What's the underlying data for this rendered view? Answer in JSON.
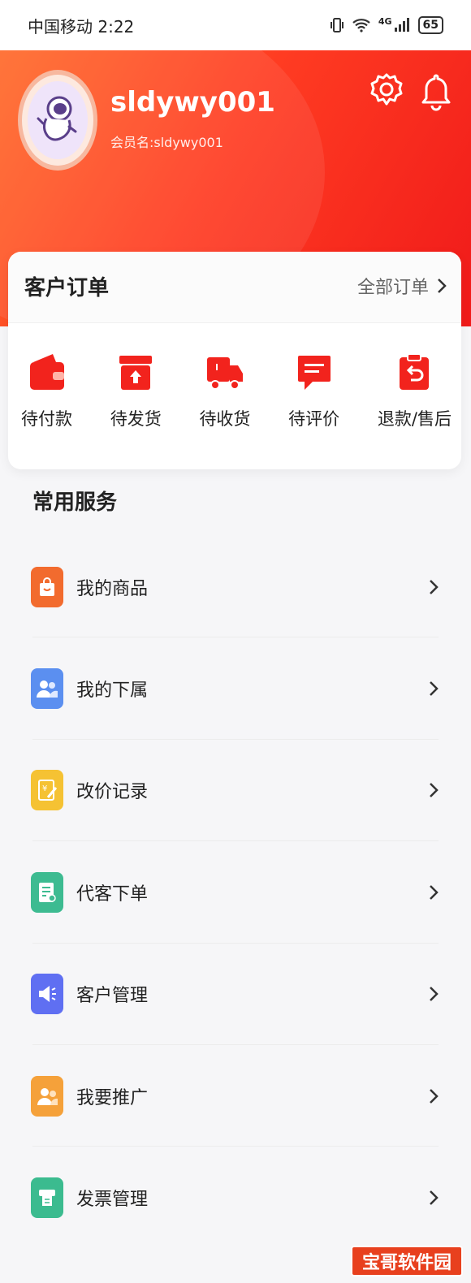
{
  "status_bar": {
    "carrier_time": "中国移动 2:22",
    "network": "4G",
    "battery": "65"
  },
  "profile": {
    "username": "sldywy001",
    "member_name": "会员名:sldywy001"
  },
  "orders": {
    "title": "客户订单",
    "all_orders_label": "全部订单",
    "items": [
      {
        "label": "待付款",
        "icon": "wallet-icon"
      },
      {
        "label": "待发货",
        "icon": "box-upload-icon"
      },
      {
        "label": "待收货",
        "icon": "truck-icon"
      },
      {
        "label": "待评价",
        "icon": "comment-icon"
      },
      {
        "label": "退款/售后",
        "icon": "return-icon"
      }
    ]
  },
  "services": {
    "title": "常用服务",
    "items": [
      {
        "label": "我的商品",
        "icon": "shopping-bag-icon",
        "color": "#f26b2e"
      },
      {
        "label": "我的下属",
        "icon": "users-icon",
        "color": "#5b8ff0"
      },
      {
        "label": "改价记录",
        "icon": "price-edit-icon",
        "color": "#f5c233"
      },
      {
        "label": "代客下单",
        "icon": "order-list-icon",
        "color": "#3dbb91"
      },
      {
        "label": "客户管理",
        "icon": "megaphone-icon",
        "color": "#5f6ff2"
      },
      {
        "label": "我要推广",
        "icon": "promote-users-icon",
        "color": "#f5a13a"
      },
      {
        "label": "发票管理",
        "icon": "invoice-printer-icon",
        "color": "#3bbb8f"
      }
    ]
  },
  "watermark": "宝哥软件园",
  "colors": {
    "brand": "#f2231d",
    "accent_orange": "#ff6a2a"
  }
}
